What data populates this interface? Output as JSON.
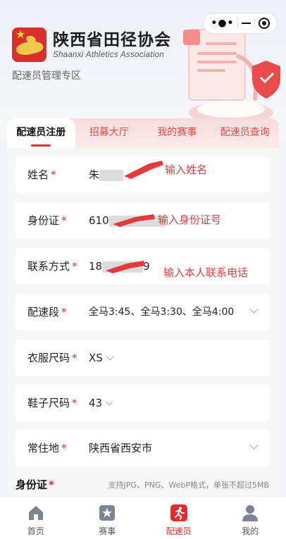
{
  "header": {
    "org_name_cn": "陕西省田径协会",
    "org_name_en": "Shaanxi Athletics Association",
    "subtitle": "配速员管理专区",
    "capsule": {
      "more_icon": "more-dots-icon",
      "minimize_icon": "minus-icon",
      "close_icon": "target-icon"
    }
  },
  "tabs": [
    {
      "label": "配速员注册",
      "active": true
    },
    {
      "label": "招募大厅",
      "active": false
    },
    {
      "label": "我的赛事",
      "active": false
    },
    {
      "label": "配速员查询",
      "active": false
    }
  ],
  "form": {
    "name": {
      "label": "姓名",
      "required_mark": "*",
      "value_prefix": "朱"
    },
    "id_card": {
      "label": "身份证",
      "required_mark": "*",
      "value_prefix": "610"
    },
    "contact": {
      "label": "联系方式",
      "required_mark": "*",
      "value_prefix": "18",
      "value_suffix": "9"
    },
    "pace": {
      "label": "配速段",
      "required_mark": "*",
      "value": "全马3:45、全马3:30、全马4:00"
    },
    "clothing_size": {
      "label": "衣服尺码",
      "required_mark": "*",
      "value": "XS"
    },
    "shoe_size": {
      "label": "鞋子尺码",
      "required_mark": "*",
      "value": "43"
    },
    "residence": {
      "label": "常住地",
      "required_mark": "*",
      "value": "陕西省西安市"
    },
    "id_photo": {
      "label": "身份证",
      "required_mark": "*",
      "hint": "支持JPG、PNG、WebP格式，单张不超过5MB"
    }
  },
  "annotations": {
    "name": "输入姓名",
    "id_card": "输入身份证号",
    "contact": "输入本人联系电话",
    "color": "#e43a3a"
  },
  "tabbar": [
    {
      "label": "首页",
      "icon": "home-icon",
      "active": false
    },
    {
      "label": "赛事",
      "icon": "star-badge-icon",
      "active": false
    },
    {
      "label": "配速员",
      "icon": "runner-icon",
      "active": true
    },
    {
      "label": "我的",
      "icon": "user-icon",
      "active": false
    }
  ],
  "colors": {
    "accent": "#e02e2e",
    "tab_bg": "#f9dcdc",
    "page_bg": "#f2f3f6"
  }
}
